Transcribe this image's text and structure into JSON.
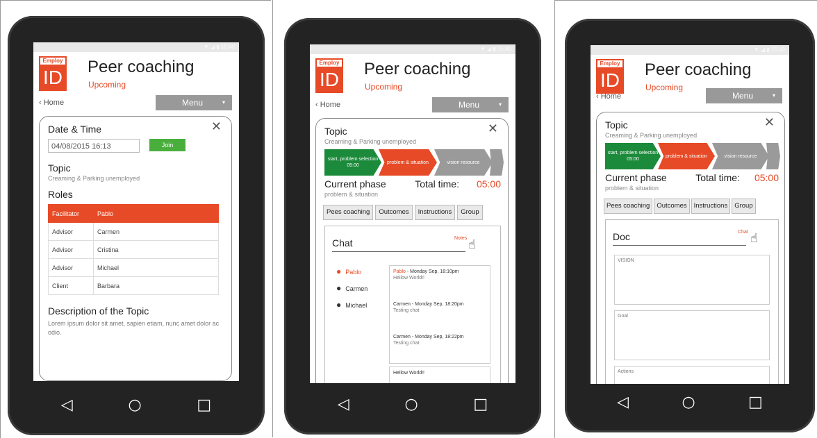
{
  "app": {
    "logo_top": "Employ",
    "logo_main": "ID",
    "title": "Peer coaching",
    "status": "Upcoming",
    "back_link": "Home",
    "menu_label": "Menu",
    "menu_caret": "▾",
    "statusbar": "▼ ◢ ▮ 15:40"
  },
  "nav": {
    "back": "◁",
    "home": "○",
    "recents": "□"
  },
  "screen1": {
    "close": "✕",
    "date_heading": "Date & Time",
    "date_value": "04/08/2015 16:13",
    "join_label": "Join",
    "topic_heading": "Topic",
    "topic_text": "Creaming & Parking unemployed",
    "roles_heading": "Roles",
    "roles": [
      {
        "role": "Facilitator",
        "name": "Pablo"
      },
      {
        "role": "Advisor",
        "name": "Carmen"
      },
      {
        "role": "Advisor",
        "name": "Cristina"
      },
      {
        "role": "Advisor",
        "name": "Michael"
      },
      {
        "role": "Client",
        "name": "Barbara"
      }
    ],
    "description_heading": "Description of the Topic",
    "description_text": "Lorem ipsum dolor sit amet, sapien etiam, nunc amet dolor ac odio."
  },
  "workflow": {
    "topic_heading": "Topic",
    "topic_text": "Creaming & Parking unemployed",
    "close": "✕",
    "steps": [
      {
        "label": "start, problem selection",
        "time": "05:00"
      },
      {
        "label": "problem & situation",
        "time": ""
      },
      {
        "label": "vision resource",
        "time": ""
      }
    ],
    "current_phase_label": "Current phase",
    "current_phase_value": "problem & situation",
    "total_time_label": "Total time:",
    "total_time_value": "05:00",
    "tabs": [
      "Pees coaching",
      "Outcomes",
      "Instructions",
      "Group"
    ]
  },
  "screen2": {
    "panel_title": "Chat",
    "switch_link": "Notes",
    "users": [
      {
        "name": "Pablo",
        "active": true
      },
      {
        "name": "Carmen",
        "active": false
      },
      {
        "name": "Michael",
        "active": false
      }
    ],
    "messages": [
      {
        "author": "Pablo",
        "time": "Monday Sep, 18:10pm",
        "text": "Hellow World!!",
        "highlight": true
      },
      {
        "author": "Carmen",
        "time": "Monday Sep, 18:20pm",
        "text": "Testing chat",
        "highlight": false
      },
      {
        "author": "Carmen",
        "time": "Monday Sep, 18:22pm",
        "text": "Testing chat",
        "highlight": false
      }
    ],
    "extra_message": "Hellow World!!"
  },
  "screen3": {
    "panel_title": "Doc",
    "switch_link": "Chat",
    "fields": [
      "VISION",
      "Goal",
      "Actions"
    ]
  },
  "colors": {
    "accent": "#e74a26",
    "green": "#1b8a3a",
    "grey": "#9a9a9a"
  }
}
